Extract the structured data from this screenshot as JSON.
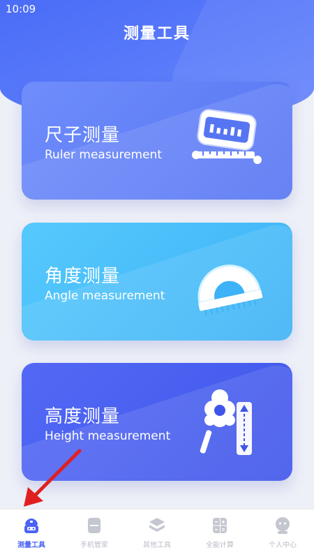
{
  "status_bar": {
    "time": "10:09"
  },
  "page": {
    "title": "测量工具"
  },
  "cards": [
    {
      "title": "尺子测量",
      "subtitle": "Ruler measurement",
      "icon": "ruler-icon"
    },
    {
      "title": "角度测量",
      "subtitle": "Angle measurement",
      "icon": "protractor-icon"
    },
    {
      "title": "高度测量",
      "subtitle": "Height measurement",
      "icon": "height-tool-icon"
    }
  ],
  "tabs": [
    {
      "label": "测量工具",
      "icon": "robot-icon",
      "active": true
    },
    {
      "label": "手机管家",
      "icon": "phone-icon",
      "active": false
    },
    {
      "label": "其他工具",
      "icon": "layers-icon",
      "active": false
    },
    {
      "label": "全能计算",
      "icon": "calculator-icon",
      "active": false
    },
    {
      "label": "个人中心",
      "icon": "user-icon",
      "active": false
    }
  ],
  "colors": {
    "accent": "#4a63f4",
    "ruler_card": "#6f8dfb",
    "angle_card": "#56c9fd",
    "height_card": "#5369f5",
    "annotation_arrow": "#e02020"
  }
}
